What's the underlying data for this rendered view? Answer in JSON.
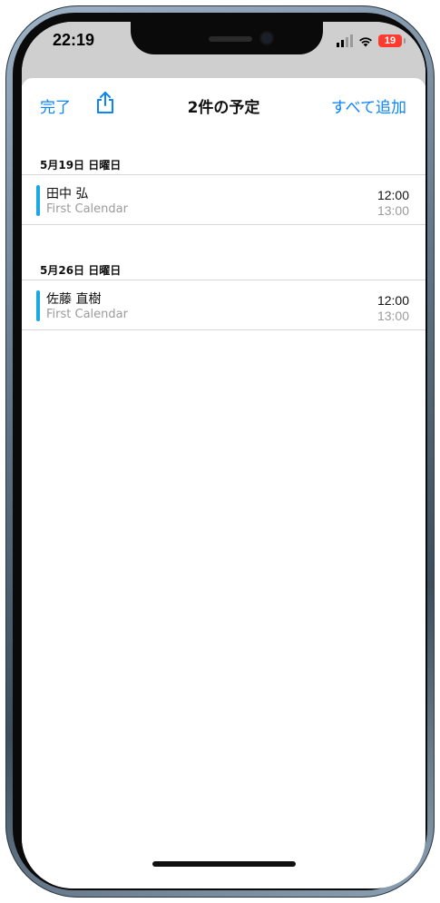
{
  "status_bar": {
    "time": "22:19",
    "battery_level": "19",
    "battery_color": "#ff3b30"
  },
  "nav": {
    "done_label": "完了",
    "share_icon": "share-icon",
    "title": "2件の予定",
    "add_all_label": "すべて追加"
  },
  "sections": [
    {
      "date_header": "5月19日 日曜日",
      "events": [
        {
          "title": "田中 弘",
          "calendar": "First Calendar",
          "start": "12:00",
          "end": "13:00",
          "color": "#1aa7e5"
        }
      ]
    },
    {
      "date_header": "5月26日 日曜日",
      "events": [
        {
          "title": "佐藤 直樹",
          "calendar": "First Calendar",
          "start": "12:00",
          "end": "13:00",
          "color": "#1aa7e5"
        }
      ]
    }
  ],
  "colors": {
    "accent": "#0a84ff"
  }
}
